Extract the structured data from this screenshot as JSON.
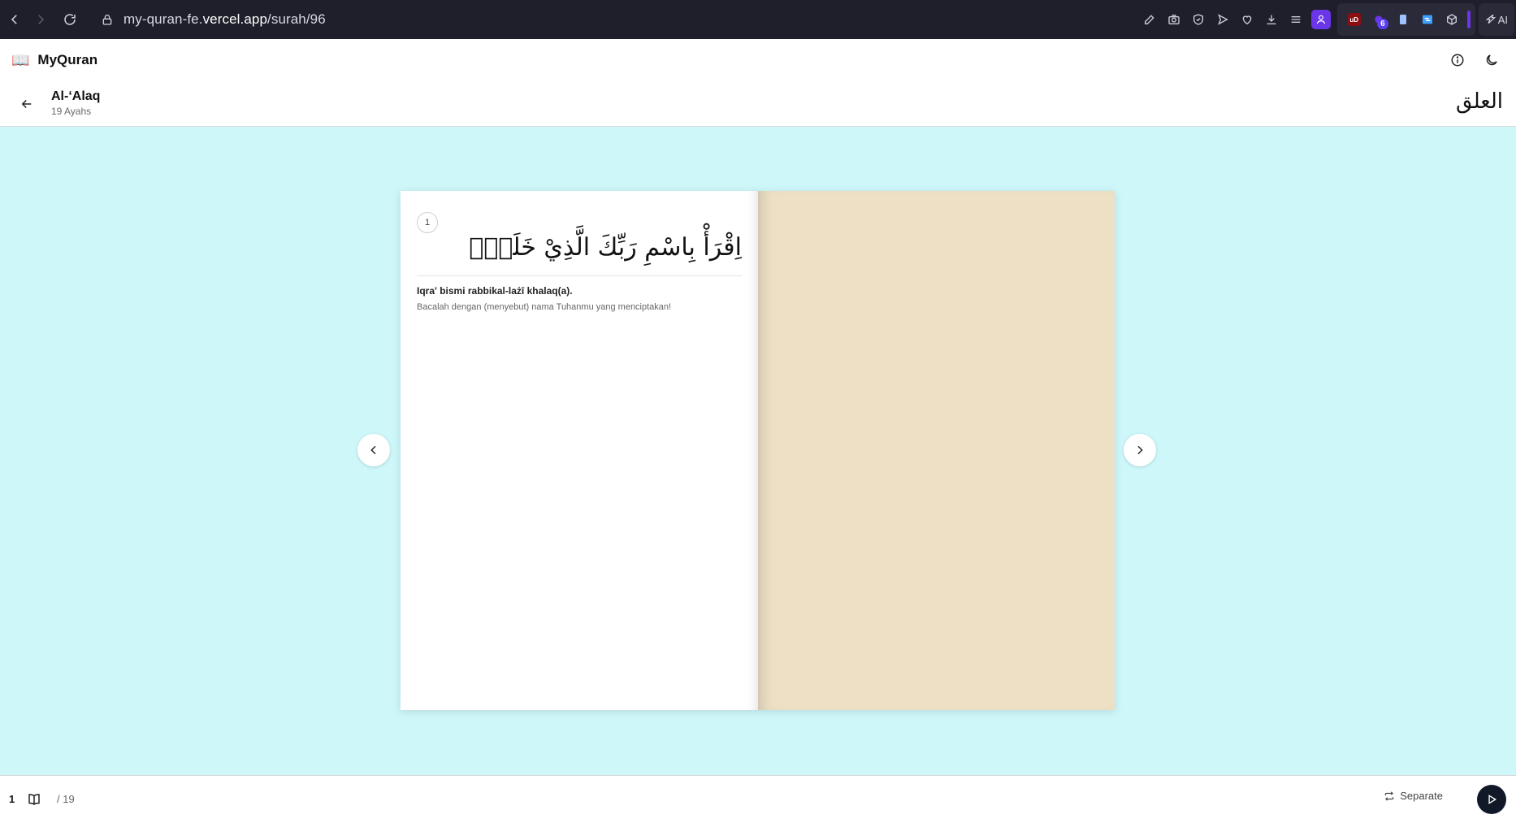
{
  "browser": {
    "url_prefix": "my-quran-fe.",
    "url_host": "vercel.app",
    "url_path": "/surah/96",
    "ext_ub_label": "uD",
    "ext_badge_count": "6",
    "ai_label": "AI"
  },
  "app": {
    "logo_icon": "📖",
    "title": "MyQuran"
  },
  "surah": {
    "name": "Al-‘Alaq",
    "ayahs_label": "19 Ayahs",
    "arabic_name": "العلق"
  },
  "page": {
    "ayah_number": "1",
    "arabic_text": "اِقْرَأْ بِاسْمِ رَبِّكَ الَّذِيْ خَلَقَۚ",
    "transliteration": "Iqra' bismi rabbikal-lażī khalaq(a).",
    "translation": "Bacalah dengan (menyebut) nama Tuhanmu yang menciptakan!"
  },
  "footer": {
    "current_page": "1",
    "total_label": "/ 19",
    "mode_label": "Separate"
  },
  "colors": {
    "reader_bg": "#cef7fa",
    "right_page": "#ede0c5",
    "play_button": "#111827"
  }
}
